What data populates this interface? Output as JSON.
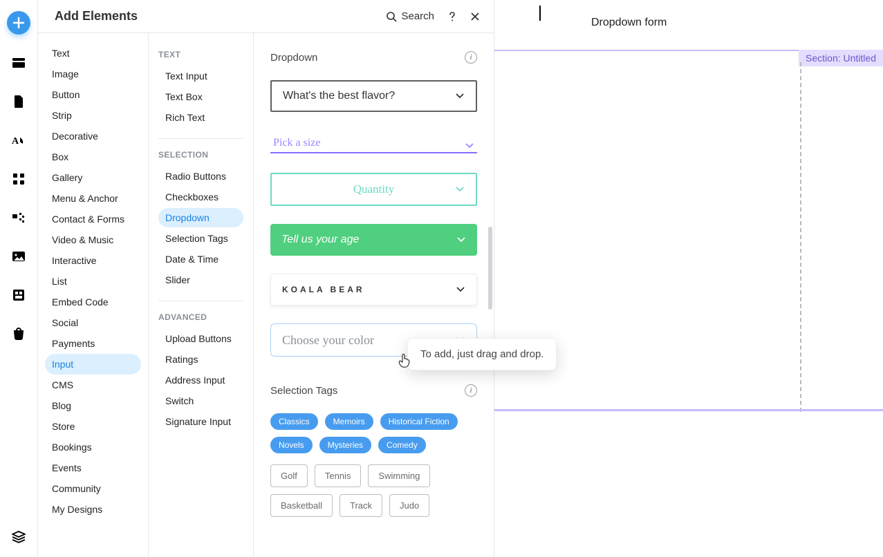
{
  "panel": {
    "title": "Add Elements",
    "search_label": "Search"
  },
  "col1": {
    "items": [
      "Text",
      "Image",
      "Button",
      "Strip",
      "Decorative",
      "Box",
      "Gallery",
      "Menu & Anchor",
      "Contact & Forms",
      "Video & Music",
      "Interactive",
      "List",
      "Embed Code",
      "Social",
      "Payments",
      "Input",
      "CMS",
      "Blog",
      "Store",
      "Bookings",
      "Events",
      "Community",
      "My Designs"
    ],
    "active_index": 15
  },
  "col2": {
    "groups": [
      {
        "heading": "TEXT",
        "items": [
          "Text Input",
          "Text Box",
          "Rich Text"
        ]
      },
      {
        "heading": "SELECTION",
        "items": [
          "Radio Buttons",
          "Checkboxes",
          "Dropdown",
          "Selection Tags",
          "Date & Time",
          "Slider"
        ],
        "active_index": 2
      },
      {
        "heading": "ADVANCED",
        "items": [
          "Upload Buttons",
          "Ratings",
          "Address Input",
          "Switch",
          "Signature Input"
        ]
      }
    ]
  },
  "preview": {
    "section1_title": "Dropdown",
    "section2_title": "Selection Tags",
    "dropdowns": {
      "d1": "What's the best flavor?",
      "d2": "Pick a size",
      "d3": "Quantity",
      "d4": "Tell us your age",
      "d5": "KOALA BEAR",
      "d6": "Choose your color"
    },
    "tags_blue": [
      "Classics",
      "Memoirs",
      "Historical Fiction",
      "Novels",
      "Mysteries",
      "Comedy"
    ],
    "tags_gray": [
      "Golf",
      "Tennis",
      "Swimming",
      "Basketball",
      "Track",
      "Judo"
    ]
  },
  "canvas": {
    "page_title": "Dropdown form",
    "section_label": "Section: Untitled"
  },
  "tooltip": {
    "text": "To add, just drag and drop."
  }
}
